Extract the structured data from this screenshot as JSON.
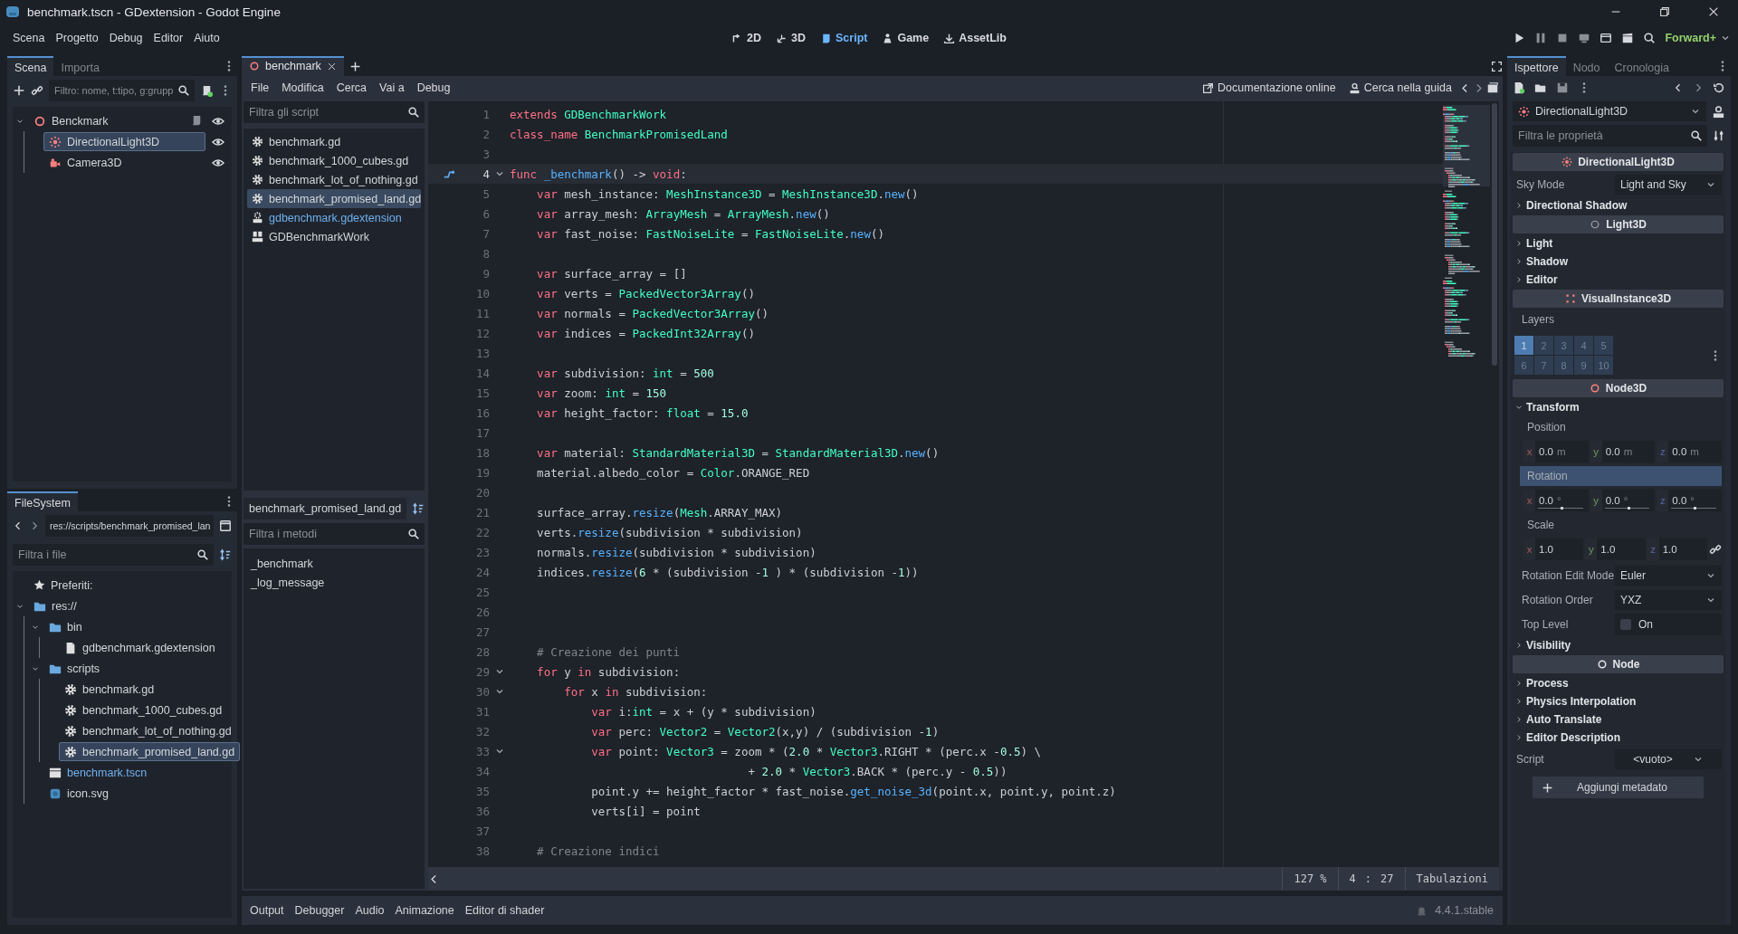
{
  "window": {
    "title": "benchmark.tscn - GDextension - Godot Engine"
  },
  "menus": [
    "Scena",
    "Progetto",
    "Debug",
    "Editor",
    "Aiuto"
  ],
  "workspaces": [
    {
      "label": "2D",
      "kind": "planar",
      "selected": false
    },
    {
      "label": "3D",
      "kind": "spatial",
      "selected": false
    },
    {
      "label": "Script",
      "kind": "script",
      "selected": true
    },
    {
      "label": "Game",
      "kind": "game",
      "selected": false
    },
    {
      "label": "AssetLib",
      "kind": "assetlib",
      "selected": false
    }
  ],
  "renderer": "Forward+",
  "scene_dock": {
    "tabs": [
      {
        "label": "Scena",
        "selected": true
      },
      {
        "label": "Importa",
        "selected": false
      }
    ],
    "filter": {
      "placeholder": "Filtro: nome, t:tipo, g:grupp"
    },
    "tree": [
      {
        "label": "Benckmark",
        "kind": "node3d",
        "expanded": true,
        "selected": false,
        "script": true,
        "visible": true,
        "children": [
          {
            "label": "DirectionalLight3D",
            "kind": "light",
            "selected": true,
            "script": false,
            "visible": true
          },
          {
            "label": "Camera3D",
            "kind": "camera",
            "selected": false,
            "script": false,
            "visible": true
          }
        ]
      }
    ]
  },
  "filesystem": {
    "tab": "FileSystem",
    "path": "res://scripts/benchmark_promised_lan",
    "filter": {
      "placeholder": "Filtra i file"
    },
    "favorites": "Preferiti:",
    "tree": [
      {
        "label": "res://",
        "kind": "folder",
        "expanded": true,
        "selected": false,
        "current": false,
        "children": [
          {
            "label": "bin",
            "kind": "folder",
            "expanded": true,
            "selected": false,
            "current": false,
            "children": [
              {
                "label": "gdbenchmark.gdextension",
                "kind": "file",
                "selected": false,
                "current": false
              }
            ]
          },
          {
            "label": "scripts",
            "kind": "folder",
            "expanded": true,
            "selected": false,
            "current": false,
            "children": [
              {
                "label": "benchmark.gd",
                "kind": "gear",
                "selected": false,
                "current": false
              },
              {
                "label": "benchmark_1000_cubes.gd",
                "kind": "gear",
                "selected": false,
                "current": false
              },
              {
                "label": "benchmark_lot_of_nothing.gd",
                "kind": "gear",
                "selected": false,
                "current": false
              },
              {
                "label": "benchmark_promised_land.gd",
                "kind": "gear",
                "selected": true,
                "current": false
              }
            ]
          },
          {
            "label": "benchmark.tscn",
            "kind": "scene",
            "selected": false,
            "current": true
          },
          {
            "label": "icon.svg",
            "kind": "image",
            "selected": false,
            "current": false
          }
        ]
      }
    ]
  },
  "script_editor": {
    "tabs": [
      {
        "label": "benchmark",
        "selected": true
      }
    ],
    "menus": [
      "File",
      "Modifica",
      "Cerca",
      "Vai a",
      "Debug"
    ],
    "help": [
      {
        "label": "Documentazione online",
        "kind": "external"
      },
      {
        "label": "Cerca nella guida",
        "kind": "help-search"
      }
    ],
    "script_filter": {
      "placeholder": "Filtra gli script"
    },
    "scripts": [
      {
        "label": "benchmark.gd",
        "kind": "script",
        "selected": false,
        "highlighted": false
      },
      {
        "label": "benchmark_1000_cubes.gd",
        "kind": "script",
        "selected": false,
        "highlighted": false
      },
      {
        "label": "benchmark_lot_of_nothing.gd",
        "kind": "script",
        "selected": false,
        "highlighted": false
      },
      {
        "label": "benchmark_promised_land.gd",
        "kind": "script",
        "selected": true,
        "highlighted": false
      },
      {
        "label": "gdbenchmark.gdextension",
        "kind": "text",
        "selected": false,
        "highlighted": true
      },
      {
        "label": "GDBenchmarkWork",
        "kind": "doc",
        "selected": false,
        "highlighted": false
      }
    ],
    "current_file": "benchmark_promised_land.gd",
    "method_filter": {
      "placeholder": "Filtra i metodi"
    },
    "methods": [
      "_benchmark",
      "_log_message"
    ],
    "lines": [
      {
        "number": "1",
        "fold": false,
        "current": false,
        "marker": false,
        "tokens": [
          {
            "kind": "keyword",
            "text": "extends "
          },
          {
            "kind": "type",
            "text": "GDBenchmarkWork"
          }
        ]
      },
      {
        "number": "2",
        "fold": false,
        "current": false,
        "marker": false,
        "tokens": [
          {
            "kind": "keyword",
            "text": "class_name "
          },
          {
            "kind": "type",
            "text": "BenchmarkPromisedLand"
          }
        ]
      },
      {
        "number": "3",
        "fold": false,
        "current": false,
        "marker": false
      },
      {
        "number": "4",
        "fold": true,
        "current": true,
        "marker": true,
        "tokens": [
          {
            "kind": "keyword",
            "text": "func "
          },
          {
            "kind": "call",
            "text": "_benchmark"
          },
          {
            "kind": "plain",
            "text": "() -> "
          },
          {
            "kind": "keyword",
            "text": "void"
          },
          {
            "kind": "plain",
            "text": ":"
          }
        ]
      },
      {
        "number": "5",
        "fold": false,
        "current": false,
        "marker": false,
        "tokens": [
          {
            "kind": "keyword",
            "text": "\tvar "
          },
          {
            "kind": "plain",
            "text": "mesh_instance: "
          },
          {
            "kind": "type",
            "text": "MeshInstance3D"
          },
          {
            "kind": "plain",
            "text": " = "
          },
          {
            "kind": "type",
            "text": "MeshInstance3D"
          },
          {
            "kind": "plain",
            "text": "."
          },
          {
            "kind": "call",
            "text": "new"
          },
          {
            "kind": "plain",
            "text": "()"
          }
        ]
      },
      {
        "number": "6",
        "fold": false,
        "current": false,
        "marker": false,
        "tokens": [
          {
            "kind": "keyword",
            "text": "\tvar "
          },
          {
            "kind": "plain",
            "text": "array_mesh: "
          },
          {
            "kind": "type",
            "text": "ArrayMesh"
          },
          {
            "kind": "plain",
            "text": " = "
          },
          {
            "kind": "type",
            "text": "ArrayMesh"
          },
          {
            "kind": "plain",
            "text": "."
          },
          {
            "kind": "call",
            "text": "new"
          },
          {
            "kind": "plain",
            "text": "()"
          }
        ]
      },
      {
        "number": "7",
        "fold": false,
        "current": false,
        "marker": false,
        "tokens": [
          {
            "kind": "keyword",
            "text": "\tvar "
          },
          {
            "kind": "plain",
            "text": "fast_noise: "
          },
          {
            "kind": "type",
            "text": "FastNoiseLite"
          },
          {
            "kind": "plain",
            "text": " = "
          },
          {
            "kind": "type",
            "text": "FastNoiseLite"
          },
          {
            "kind": "plain",
            "text": "."
          },
          {
            "kind": "call",
            "text": "new"
          },
          {
            "kind": "plain",
            "text": "()"
          }
        ]
      },
      {
        "number": "8",
        "fold": false,
        "current": false,
        "marker": false
      },
      {
        "number": "9",
        "fold": false,
        "current": false,
        "marker": false,
        "tokens": [
          {
            "kind": "keyword",
            "text": "\tvar "
          },
          {
            "kind": "plain",
            "text": "surface_array = []"
          }
        ]
      },
      {
        "number": "10",
        "fold": false,
        "current": false,
        "marker": false,
        "tokens": [
          {
            "kind": "keyword",
            "text": "\tvar "
          },
          {
            "kind": "plain",
            "text": "verts = "
          },
          {
            "kind": "type",
            "text": "PackedVector3Array"
          },
          {
            "kind": "plain",
            "text": "()"
          }
        ]
      },
      {
        "number": "11",
        "fold": false,
        "current": false,
        "marker": false,
        "tokens": [
          {
            "kind": "keyword",
            "text": "\tvar "
          },
          {
            "kind": "plain",
            "text": "normals = "
          },
          {
            "kind": "type",
            "text": "PackedVector3Array"
          },
          {
            "kind": "plain",
            "text": "()"
          }
        ]
      },
      {
        "number": "12",
        "fold": false,
        "current": false,
        "marker": false,
        "tokens": [
          {
            "kind": "keyword",
            "text": "\tvar "
          },
          {
            "kind": "plain",
            "text": "indices = "
          },
          {
            "kind": "type",
            "text": "PackedInt32Array"
          },
          {
            "kind": "plain",
            "text": "()"
          }
        ]
      },
      {
        "number": "13",
        "fold": false,
        "current": false,
        "marker": false
      },
      {
        "number": "14",
        "fold": false,
        "current": false,
        "marker": false,
        "tokens": [
          {
            "kind": "keyword",
            "text": "\tvar "
          },
          {
            "kind": "plain",
            "text": "subdivision: "
          },
          {
            "kind": "type",
            "text": "int"
          },
          {
            "kind": "plain",
            "text": " = "
          },
          {
            "kind": "number",
            "text": "500"
          }
        ]
      },
      {
        "number": "15",
        "fold": false,
        "current": false,
        "marker": false,
        "tokens": [
          {
            "kind": "keyword",
            "text": "\tvar "
          },
          {
            "kind": "plain",
            "text": "zoom: "
          },
          {
            "kind": "type",
            "text": "int"
          },
          {
            "kind": "plain",
            "text": " = "
          },
          {
            "kind": "number",
            "text": "150"
          }
        ]
      },
      {
        "number": "16",
        "fold": false,
        "current": false,
        "marker": false,
        "tokens": [
          {
            "kind": "keyword",
            "text": "\tvar "
          },
          {
            "kind": "plain",
            "text": "height_factor: "
          },
          {
            "kind": "type",
            "text": "float"
          },
          {
            "kind": "plain",
            "text": " = "
          },
          {
            "kind": "number",
            "text": "15.0"
          }
        ]
      },
      {
        "number": "17",
        "fold": false,
        "current": false,
        "marker": false
      },
      {
        "number": "18",
        "fold": false,
        "current": false,
        "marker": false,
        "tokens": [
          {
            "kind": "keyword",
            "text": "\tvar "
          },
          {
            "kind": "plain",
            "text": "material: "
          },
          {
            "kind": "type",
            "text": "StandardMaterial3D"
          },
          {
            "kind": "plain",
            "text": " = "
          },
          {
            "kind": "type",
            "text": "StandardMaterial3D"
          },
          {
            "kind": "plain",
            "text": "."
          },
          {
            "kind": "call",
            "text": "new"
          },
          {
            "kind": "plain",
            "text": "()"
          }
        ]
      },
      {
        "number": "19",
        "fold": false,
        "current": false,
        "marker": false,
        "tokens": [
          {
            "kind": "plain",
            "text": "\tmaterial.albedo_color = "
          },
          {
            "kind": "type",
            "text": "Color"
          },
          {
            "kind": "plain",
            "text": ".ORANGE_RED"
          }
        ]
      },
      {
        "number": "20",
        "fold": false,
        "current": false,
        "marker": false
      },
      {
        "number": "21",
        "fold": false,
        "current": false,
        "marker": false,
        "tokens": [
          {
            "kind": "plain",
            "text": "\tsurface_array."
          },
          {
            "kind": "call",
            "text": "resize"
          },
          {
            "kind": "plain",
            "text": "("
          },
          {
            "kind": "type",
            "text": "Mesh"
          },
          {
            "kind": "plain",
            "text": ".ARRAY_MAX)"
          }
        ]
      },
      {
        "number": "22",
        "fold": false,
        "current": false,
        "marker": false,
        "tokens": [
          {
            "kind": "plain",
            "text": "\tverts."
          },
          {
            "kind": "call",
            "text": "resize"
          },
          {
            "kind": "plain",
            "text": "(subdivision * subdivision)"
          }
        ]
      },
      {
        "number": "23",
        "fold": false,
        "current": false,
        "marker": false,
        "tokens": [
          {
            "kind": "plain",
            "text": "\tnormals."
          },
          {
            "kind": "call",
            "text": "resize"
          },
          {
            "kind": "plain",
            "text": "(subdivision * subdivision)"
          }
        ]
      },
      {
        "number": "24",
        "fold": false,
        "current": false,
        "marker": false,
        "tokens": [
          {
            "kind": "plain",
            "text": "\tindices."
          },
          {
            "kind": "call",
            "text": "resize"
          },
          {
            "kind": "plain",
            "text": "("
          },
          {
            "kind": "number",
            "text": "6"
          },
          {
            "kind": "plain",
            "text": " * (subdivision -"
          },
          {
            "kind": "number",
            "text": "1"
          },
          {
            "kind": "plain",
            "text": " ) * (subdivision -"
          },
          {
            "kind": "number",
            "text": "1"
          },
          {
            "kind": "plain",
            "text": "))"
          }
        ]
      },
      {
        "number": "25",
        "fold": false,
        "current": false,
        "marker": false
      },
      {
        "number": "26",
        "fold": false,
        "current": false,
        "marker": false
      },
      {
        "number": "27",
        "fold": false,
        "current": false,
        "marker": false
      },
      {
        "number": "28",
        "fold": false,
        "current": false,
        "marker": false,
        "tokens": [
          {
            "kind": "comment",
            "text": "\t# Creazione dei punti"
          }
        ]
      },
      {
        "number": "29",
        "fold": true,
        "current": false,
        "marker": false,
        "tokens": [
          {
            "kind": "keyword",
            "text": "\tfor "
          },
          {
            "kind": "plain",
            "text": "y "
          },
          {
            "kind": "keyword",
            "text": "in "
          },
          {
            "kind": "plain",
            "text": "subdivision:"
          }
        ]
      },
      {
        "number": "30",
        "fold": true,
        "current": false,
        "marker": false,
        "tokens": [
          {
            "kind": "keyword",
            "text": "\t\tfor "
          },
          {
            "kind": "plain",
            "text": "x "
          },
          {
            "kind": "keyword",
            "text": "in "
          },
          {
            "kind": "plain",
            "text": "subdivision:"
          }
        ]
      },
      {
        "number": "31",
        "fold": false,
        "current": false,
        "marker": false,
        "tokens": [
          {
            "kind": "keyword",
            "text": "\t\t\tvar "
          },
          {
            "kind": "plain",
            "text": "i:"
          },
          {
            "kind": "type",
            "text": "int"
          },
          {
            "kind": "plain",
            "text": " = x + (y * subdivision)"
          }
        ]
      },
      {
        "number": "32",
        "fold": false,
        "current": false,
        "marker": false,
        "tokens": [
          {
            "kind": "keyword",
            "text": "\t\t\tvar "
          },
          {
            "kind": "plain",
            "text": "perc: "
          },
          {
            "kind": "type",
            "text": "Vector2"
          },
          {
            "kind": "plain",
            "text": " = "
          },
          {
            "kind": "type",
            "text": "Vector2"
          },
          {
            "kind": "plain",
            "text": "(x,y) / (subdivision -"
          },
          {
            "kind": "number",
            "text": "1"
          },
          {
            "kind": "plain",
            "text": ")"
          }
        ]
      },
      {
        "number": "33",
        "fold": true,
        "current": false,
        "marker": false,
        "tokens": [
          {
            "kind": "keyword",
            "text": "\t\t\tvar "
          },
          {
            "kind": "plain",
            "text": "point: "
          },
          {
            "kind": "type",
            "text": "Vector3"
          },
          {
            "kind": "plain",
            "text": " = zoom * ("
          },
          {
            "kind": "number",
            "text": "2.0"
          },
          {
            "kind": "plain",
            "text": " * "
          },
          {
            "kind": "type",
            "text": "Vector3"
          },
          {
            "kind": "plain",
            "text": ".RIGHT * (perc.x -"
          },
          {
            "kind": "number",
            "text": "0.5"
          },
          {
            "kind": "plain",
            "text": ") \\"
          }
        ]
      },
      {
        "number": "34",
        "fold": false,
        "current": false,
        "marker": false,
        "tokens": [
          {
            "kind": "plain",
            "text": "\t\t\t                       + "
          },
          {
            "kind": "number",
            "text": "2.0"
          },
          {
            "kind": "plain",
            "text": " * "
          },
          {
            "kind": "type",
            "text": "Vector3"
          },
          {
            "kind": "plain",
            "text": ".BACK * (perc.y - "
          },
          {
            "kind": "number",
            "text": "0.5"
          },
          {
            "kind": "plain",
            "text": "))"
          }
        ]
      },
      {
        "number": "35",
        "fold": false,
        "current": false,
        "marker": false,
        "tokens": [
          {
            "kind": "plain",
            "text": "\t\t\tpoint.y += height_factor * fast_noise."
          },
          {
            "kind": "call",
            "text": "get_noise_3d"
          },
          {
            "kind": "plain",
            "text": "(point.x, point.y, point.z)"
          }
        ]
      },
      {
        "number": "36",
        "fold": false,
        "current": false,
        "marker": false,
        "tokens": [
          {
            "kind": "plain",
            "text": "\t\t\tverts[i] = point"
          }
        ]
      },
      {
        "number": "37",
        "fold": false,
        "current": false,
        "marker": false
      },
      {
        "number": "38",
        "fold": false,
        "current": false,
        "marker": false,
        "tokens": [
          {
            "kind": "comment",
            "text": "\t# Creazione indici"
          }
        ]
      }
    ],
    "status": {
      "zoom": "127 %",
      "line": "4",
      "separator": ":",
      "column": "27",
      "indent": "Tabulazioni"
    }
  },
  "bottom_panel": {
    "tabs": [
      "Output",
      "Debugger",
      "Audio",
      "Animazione",
      "Editor di shader"
    ],
    "version": "4.4.1.stable"
  },
  "inspector": {
    "tabs": [
      {
        "label": "Ispettore",
        "selected": true
      },
      {
        "label": "Nodo",
        "selected": false
      },
      {
        "label": "Cronologia",
        "selected": false
      }
    ],
    "object": {
      "label": "DirectionalLight3D"
    },
    "filter": {
      "placeholder": "Filtra le proprietà"
    },
    "rows": [
      {
        "kind": "category",
        "label": "DirectionalLight3D"
      },
      {
        "kind": "dropdown",
        "label": "Sky Mode",
        "value": "Light and Sky"
      },
      {
        "kind": "group",
        "label": "Directional Shadow",
        "expanded": false
      },
      {
        "kind": "category",
        "label": "Light3D"
      },
      {
        "kind": "group",
        "label": "Light",
        "expanded": false
      },
      {
        "kind": "group",
        "label": "Shadow",
        "expanded": false
      },
      {
        "kind": "group",
        "label": "Editor",
        "expanded": false
      },
      {
        "kind": "category",
        "label": "VisualInstance3D"
      },
      {
        "kind": "label",
        "label": "Layers"
      },
      {
        "kind": "layers",
        "cells": [
          {
            "label": "1",
            "selected": true
          },
          {
            "label": "2",
            "selected": false
          },
          {
            "label": "3",
            "selected": false
          },
          {
            "label": "4",
            "selected": false
          },
          {
            "label": "5",
            "selected": false
          },
          {
            "label": "6",
            "selected": false
          },
          {
            "label": "7",
            "selected": false
          },
          {
            "label": "8",
            "selected": false
          },
          {
            "label": "9",
            "selected": false
          },
          {
            "label": "10",
            "selected": false
          }
        ]
      },
      {
        "kind": "category",
        "label": "Node3D"
      },
      {
        "kind": "group",
        "label": "Transform",
        "expanded": true,
        "children": [
          {
            "kind": "label",
            "label": "Position",
            "selected": false
          },
          {
            "kind": "vector",
            "fields": [
              {
                "axis": "x",
                "value": "0.0",
                "unit": "m"
              },
              {
                "axis": "y",
                "value": "0.0",
                "unit": "m"
              },
              {
                "axis": "z",
                "value": "0.0",
                "unit": "m"
              }
            ]
          },
          {
            "kind": "label",
            "label": "Rotation",
            "selected": true
          },
          {
            "kind": "vector",
            "fields": [
              {
                "axis": "x",
                "value": "0.0",
                "unit": "°",
                "level": 0.5
              },
              {
                "axis": "y",
                "value": "0.0",
                "unit": "°",
                "level": 0.5
              },
              {
                "axis": "z",
                "value": "0.0",
                "unit": "°",
                "level": 0.5
              }
            ]
          },
          {
            "kind": "label",
            "label": "Scale",
            "selected": false
          },
          {
            "kind": "vector",
            "linked": true,
            "fields": [
              {
                "axis": "x",
                "value": "1.0"
              },
              {
                "axis": "y",
                "value": "1.0"
              },
              {
                "axis": "z",
                "value": "1.0"
              }
            ]
          },
          {
            "kind": "dropdown",
            "label": "Rotation Edit Mode",
            "value": "Euler"
          },
          {
            "kind": "dropdown",
            "label": "Rotation Order",
            "value": "YXZ"
          },
          {
            "kind": "checkbox",
            "label": "Top Level",
            "text": "On",
            "checked": false
          }
        ]
      },
      {
        "kind": "group",
        "label": "Visibility",
        "expanded": false
      },
      {
        "kind": "category",
        "label": "Node"
      },
      {
        "kind": "group",
        "label": "Process",
        "expanded": false
      },
      {
        "kind": "group",
        "label": "Physics Interpolation",
        "expanded": false
      },
      {
        "kind": "group",
        "label": "Auto Translate",
        "expanded": false
      },
      {
        "kind": "group",
        "label": "Editor Description",
        "expanded": false
      },
      {
        "kind": "resource",
        "label": "Script",
        "value": "<vuoto>"
      },
      {
        "kind": "button",
        "label": "Aggiungi metadato"
      }
    ]
  }
}
